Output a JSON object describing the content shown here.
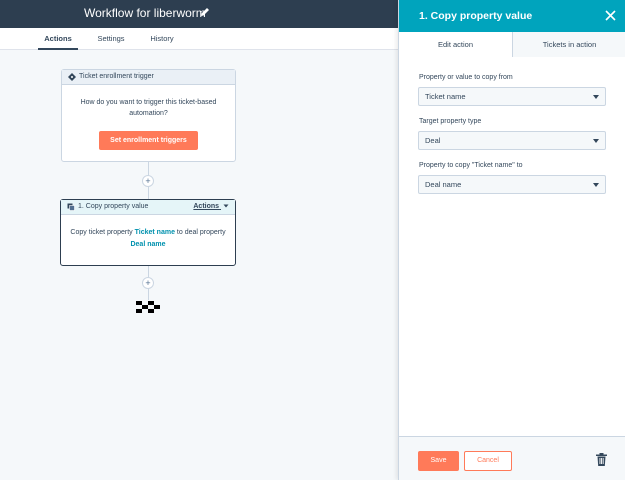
{
  "header": {
    "title": "Workflow for liberworm"
  },
  "tabs": [
    {
      "label": "Actions",
      "active": true
    },
    {
      "label": "Settings",
      "active": false
    },
    {
      "label": "History",
      "active": false
    }
  ],
  "trigger_card": {
    "title": "Ticket enrollment trigger",
    "description": "How do you want to trigger this ticket-based automation?",
    "button_label": "Set enrollment triggers"
  },
  "add_buttons": [
    "+",
    "+"
  ],
  "action_card": {
    "title": "1. Copy property value",
    "actions_label": "Actions",
    "text_prefix": "Copy ticket property",
    "source_property": "Ticket name",
    "text_middle": "to deal property",
    "target_property": "Deal name"
  },
  "panel": {
    "title": "1. Copy property value",
    "tabs": [
      {
        "label": "Edit action",
        "active": true
      },
      {
        "label": "Tickets in action",
        "active": false
      }
    ],
    "fields": [
      {
        "label": "Property or value to copy from",
        "value": "Ticket name"
      },
      {
        "label": "Target property type",
        "value": "Deal"
      },
      {
        "label": "Property to copy \"Ticket name\" to",
        "value": "Deal name"
      }
    ],
    "save_label": "Save",
    "cancel_label": "Cancel"
  },
  "colors": {
    "topbar": "#2d3e50",
    "panel_header": "#00a4bd",
    "accent": "#ff7a59",
    "link": "#0091ae"
  },
  "icons": [
    "pencil-icon",
    "ticket-icon",
    "copy-icon",
    "chevron-down-icon",
    "plus-icon",
    "finish-flag-icon",
    "close-icon",
    "caret-down-icon",
    "trash-icon"
  ]
}
